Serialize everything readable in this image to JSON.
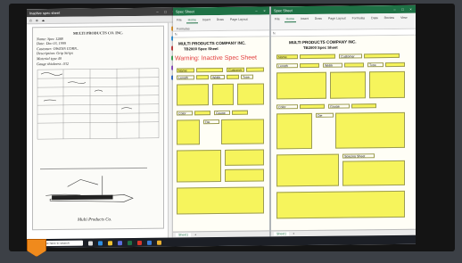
{
  "pdf_window": {
    "title": "Inactive spec sheet",
    "page_title": "MULTI PRODUCTS CO. INC.",
    "form_lines": [
      "Name: Spec 1288",
      "Date: Dec 03, 1999",
      "Customer: OWENS CORN..",
      "Description: Grip Strips",
      "Material type 40",
      "Gauge thickness .032"
    ],
    "signature": "Multi Products Co."
  },
  "excel_left": {
    "title": "Spec Sheet",
    "company": "MULTI PRODUCTS COMPANY INC.",
    "sheet_name": "TB2000 Spec Sheet",
    "warning": "Warning: Inactive Spec Sheet",
    "labels": [
      "Name",
      "Customer",
      "Length",
      "Width",
      "Type",
      "Color",
      "Gauge",
      "Die"
    ],
    "tab": "Sheet1"
  },
  "excel_right": {
    "title": "Spec Sheet",
    "company": "MULTI PRODUCTS COMPANY INC.",
    "sheet_name": "TB2000 Spec Sheet",
    "labels": [
      "Name",
      "Customer",
      "Length",
      "Width",
      "Type",
      "Color",
      "Gauge",
      "Die",
      "Spacing Sheet"
    ],
    "tab": "Sheet1"
  },
  "ribbon_tabs": [
    "File",
    "Home",
    "Insert",
    "Draw",
    "Page Layout",
    "Formulas",
    "Data",
    "Review",
    "View"
  ],
  "colors": {
    "excel_green": "#1e7145",
    "cell_yellow": "#f6f45c",
    "warning_red": "#e23a3a"
  },
  "taskbar": {
    "search_placeholder": "Type here to search"
  }
}
